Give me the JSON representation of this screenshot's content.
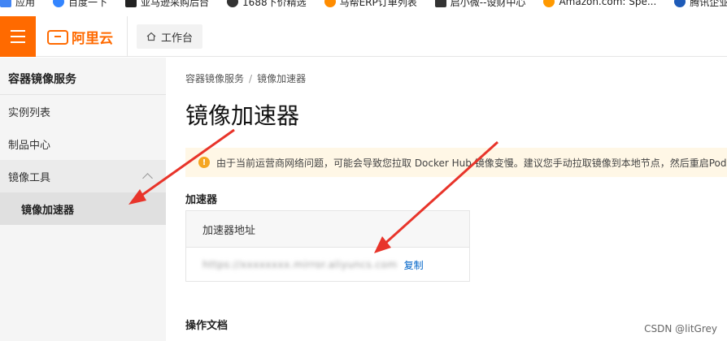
{
  "bookmarks": [
    {
      "label": "应用",
      "color": "#4285f4"
    },
    {
      "label": "百度一下",
      "color": "#3385ff"
    },
    {
      "label": "亚马逊采购后台",
      "color": "#222222"
    },
    {
      "label": "1688下价精选",
      "color": "#333333"
    },
    {
      "label": "马帮ERP订单列表",
      "color": "#ff8c00"
    },
    {
      "label": "启小微--设财中心",
      "color": "#333333"
    },
    {
      "label": "Amazon.com: Spe...",
      "color": "#f90"
    },
    {
      "label": "腾讯企业邮",
      "color": "#1e5bb8"
    }
  ],
  "header": {
    "brand": "阿里云",
    "workbench": "工作台"
  },
  "sidebar": {
    "title": "容器镜像服务",
    "items": [
      {
        "label": "实例列表"
      },
      {
        "label": "制品中心"
      },
      {
        "label": "镜像工具"
      },
      {
        "label": "镜像加速器"
      }
    ]
  },
  "main": {
    "breadcrumb": [
      "容器镜像服务",
      "镜像加速器"
    ],
    "title": "镜像加速器",
    "notice": "由于当前运营商网络问题，可能会导致您拉取 Docker Hub 镜像变慢。建议您手动拉取镜像到本地节点，然后重启Pod。",
    "section_label": "加速器",
    "table_header": "加速器地址",
    "accelerator_url": "https://xxxxxxxx.mirror.aliyuncs.com",
    "copy_label": "复制",
    "docs_label": "操作文档"
  },
  "watermark": "CSDN @litGrey",
  "colors": {
    "brand": "#ff6a00",
    "link": "#0064c8",
    "notice_bg": "#fff7e6",
    "arrow": "#e8342a"
  }
}
